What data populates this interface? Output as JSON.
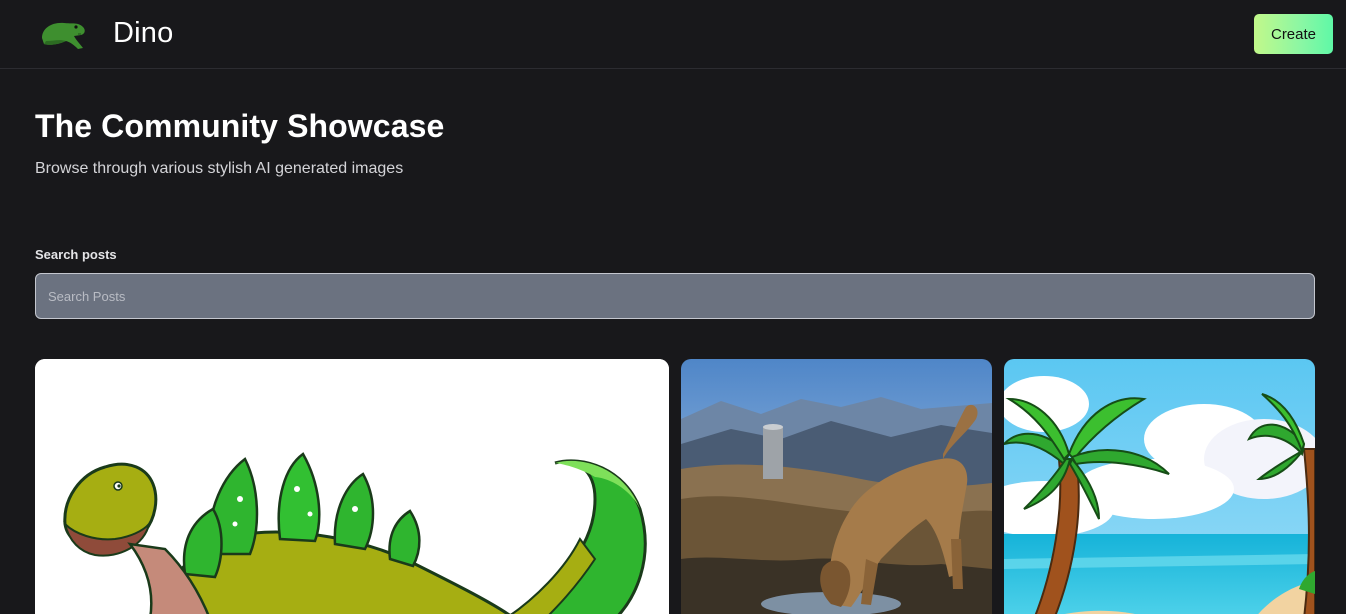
{
  "header": {
    "brand": "Dino",
    "create_label": "Create",
    "logo_icon": "dinosaur-head-icon",
    "accent_gradient": [
      "#c2f88a",
      "#5ff8a6"
    ]
  },
  "hero": {
    "title": "The Community Showcase",
    "subtitle": "Browse through various stylish AI generated images"
  },
  "search": {
    "label": "Search posts",
    "placeholder": "Search Posts",
    "value": ""
  },
  "posts": [
    {
      "subject": "cartoon green stegosaurus-like dinosaur"
    },
    {
      "subject": "shaggy dog drinking from puddle on mountain"
    },
    {
      "subject": "cartoon palm trees on tropical beach"
    }
  ]
}
